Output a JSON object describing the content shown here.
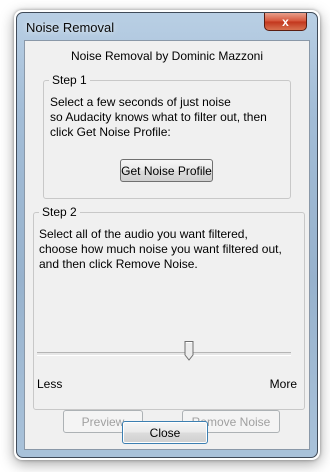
{
  "window": {
    "title": "Noise Removal",
    "close_glyph": "x"
  },
  "dialog": {
    "byline": "Noise Removal by Dominic Mazzoni",
    "step1": {
      "legend": "Step 1",
      "lines": [
        "Select a few seconds of just noise",
        "so Audacity knows what to filter out, then",
        "click Get Noise Profile:"
      ],
      "button_label": "Get Noise Profile"
    },
    "step2": {
      "legend": "Step 2",
      "lines": [
        "Select all of the audio you want filtered,",
        "choose how much noise you want filtered out,",
        "and then click Remove Noise."
      ],
      "slider": {
        "min_label": "Less",
        "max_label": "More",
        "value_fraction": 0.62
      },
      "preview_label": "Preview",
      "remove_label": "Remove Noise"
    },
    "close_label": "Close"
  },
  "colors": {
    "title_close": "#c8391f",
    "disabled_text": "#a0a0a0",
    "focus_border": "#3c7fb1"
  }
}
